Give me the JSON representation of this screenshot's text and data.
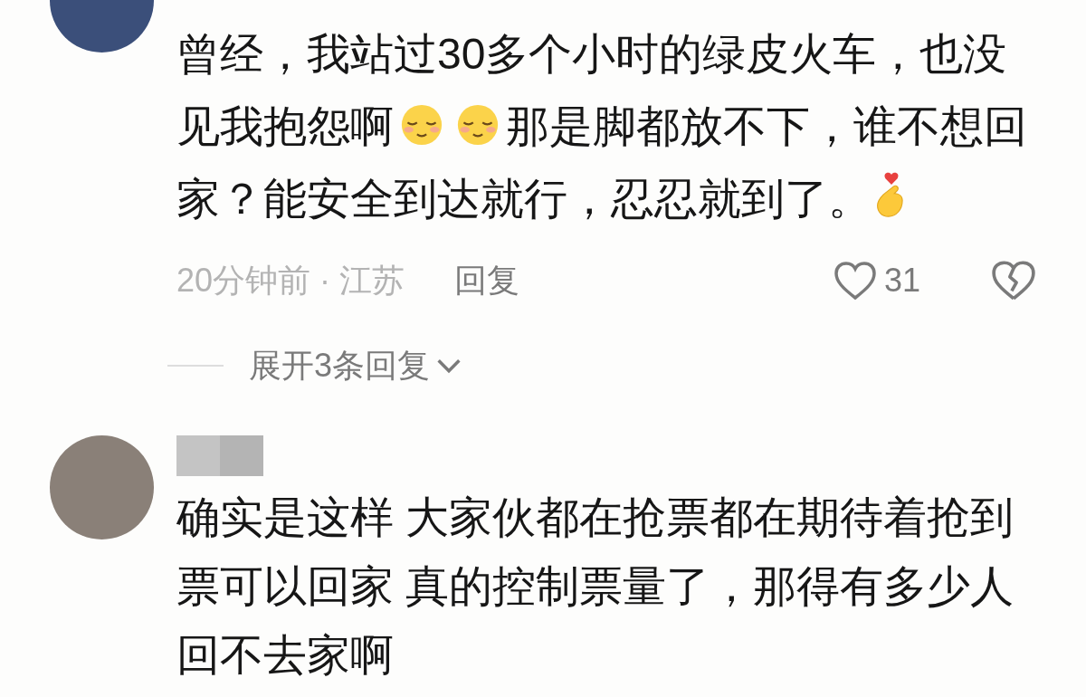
{
  "comments": [
    {
      "segments": [
        {
          "kind": "text",
          "text": "曾经，我站过30多个小时的绿皮火车，也没见我抱怨啊"
        },
        {
          "kind": "relieved"
        },
        {
          "kind": "relieved"
        },
        {
          "kind": "text",
          "text": "那是脚都放不下，谁不想回家？能安全到达就行，忍忍就到了。"
        },
        {
          "kind": "fingerheart"
        }
      ],
      "time": "20分钟前",
      "separator": "·",
      "location": "江苏",
      "reply_label": "回复",
      "likes": "31",
      "expand_label": "展开3条回复"
    },
    {
      "username_redacted": true,
      "segments": [
        {
          "kind": "text",
          "text": "确实是这样 大家伙都在抢票都在期待着抢到票可以回家 真的控制票量了，那得有多少人回不去家啊"
        }
      ]
    }
  ]
}
